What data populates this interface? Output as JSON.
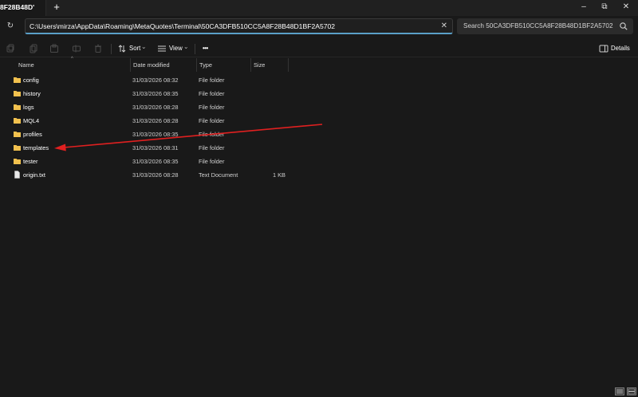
{
  "tab": {
    "label": "8F28B48D'",
    "close_glyph": "✕",
    "new_tab_glyph": "+"
  },
  "window_controls": {
    "minimize": "–",
    "maximize": "⧉",
    "close": "✕"
  },
  "address": {
    "path": "C:\\Users\\mirza\\AppData\\Roaming\\MetaQuotes\\Terminal\\50CA3DFB510CC5A8F28B48D1BF2A5702",
    "clear_glyph": "✕",
    "refresh_glyph": "↻"
  },
  "search": {
    "placeholder": "Search 50CA3DFB510CC5A8F28B48D1BF2A5702"
  },
  "toolbar": {
    "sort_label": "Sort",
    "view_label": "View",
    "more_label": "•••",
    "details_label": "Details",
    "caret": "⌄"
  },
  "columns": {
    "name": "Name",
    "date_modified": "Date modified",
    "type": "Type",
    "size": "Size",
    "sort_caret": "^"
  },
  "files": [
    {
      "name": "config",
      "date": "31/03/2026 08:32",
      "type": "File folder",
      "size": "",
      "icon": "folder-icon"
    },
    {
      "name": "history",
      "date": "31/03/2026 08:35",
      "type": "File folder",
      "size": "",
      "icon": "folder-icon"
    },
    {
      "name": "logs",
      "date": "31/03/2026 08:28",
      "type": "File folder",
      "size": "",
      "icon": "folder-icon"
    },
    {
      "name": "MQL4",
      "date": "31/03/2026 08:28",
      "type": "File folder",
      "size": "",
      "icon": "folder-icon"
    },
    {
      "name": "profiles",
      "date": "31/03/2026 08:35",
      "type": "File folder",
      "size": "",
      "icon": "folder-icon"
    },
    {
      "name": "templates",
      "date": "31/03/2026 08:31",
      "type": "File folder",
      "size": "",
      "icon": "folder-icon"
    },
    {
      "name": "tester",
      "date": "31/03/2026 08:35",
      "type": "File folder",
      "size": "",
      "icon": "folder-icon"
    },
    {
      "name": "origin.txt",
      "date": "31/03/2026 08:28",
      "type": "Text Document",
      "size": "1 KB",
      "icon": "text-file-icon"
    }
  ],
  "annotation": {
    "arrow_color": "#e02020",
    "points_to": "templates"
  },
  "colors": {
    "folder": "#f2c14e",
    "accent": "#5aa0c8",
    "background": "#191919"
  }
}
